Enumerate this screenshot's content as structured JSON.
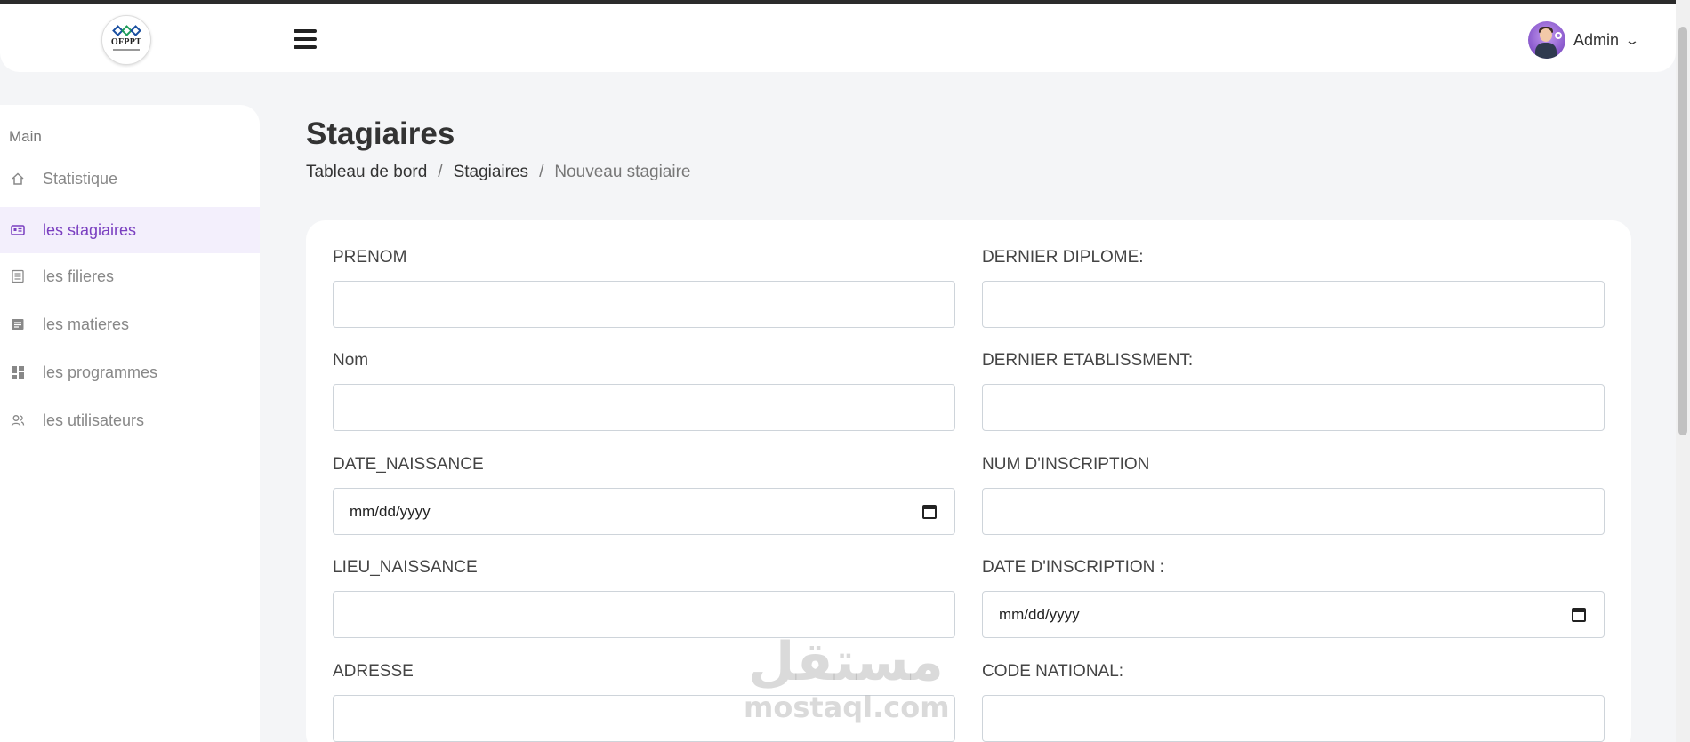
{
  "header": {
    "logo_text": "OFPPT",
    "user_name": "Admin",
    "icons": {
      "menu": "hamburger-icon",
      "dropdown": "chevron-down-icon"
    }
  },
  "sidebar": {
    "section": "Main",
    "items": [
      {
        "label": "Statistique",
        "icon": "home-icon",
        "active": false
      },
      {
        "label": "les stagiaires",
        "icon": "id-card-icon",
        "active": true
      },
      {
        "label": "les filieres",
        "icon": "list-icon",
        "active": false
      },
      {
        "label": "les matieres",
        "icon": "document-icon",
        "active": false
      },
      {
        "label": "les programmes",
        "icon": "grid-icon",
        "active": false
      },
      {
        "label": "les utilisateurs",
        "icon": "users-icon",
        "active": false
      }
    ]
  },
  "page": {
    "title": "Stagiaires",
    "breadcrumb": [
      "Tableau de bord",
      "Stagiaires",
      "Nouveau stagiaire"
    ],
    "breadcrumb_sep": "/"
  },
  "form": {
    "left": [
      {
        "label": "PRENOM",
        "value": ""
      },
      {
        "label": "Nom",
        "value": ""
      },
      {
        "label": "DATE_NAISSANCE",
        "placeholder": "mm/dd/yyyy"
      },
      {
        "label": "LIEU_NAISSANCE",
        "value": ""
      },
      {
        "label": "ADRESSE",
        "value": ""
      }
    ],
    "right": [
      {
        "label": "DERNIER DIPLOME:",
        "value": ""
      },
      {
        "label": "DERNIER ETABLISSMENT:",
        "value": ""
      },
      {
        "label": "NUM D'INSCRIPTION",
        "value": ""
      },
      {
        "label": "DATE D'INSCRIPTION :",
        "placeholder": "mm/dd/yyyy"
      },
      {
        "label": "CODE NATIONAL:",
        "value": ""
      }
    ]
  },
  "watermark": {
    "arabic": "مستقل",
    "latin": "mostaql.com"
  },
  "colors": {
    "accent": "#7a3fc0",
    "active_bg": "#f3effc",
    "page_bg": "#f4f5f7"
  }
}
